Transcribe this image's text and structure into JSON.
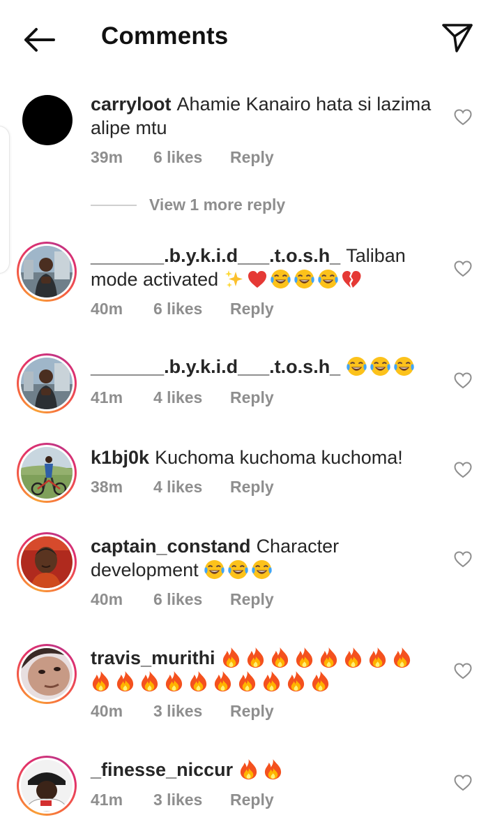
{
  "header": {
    "title": "Comments",
    "back_icon": "arrow-left-icon",
    "share_icon": "paper-plane-icon"
  },
  "view_more_replies": "View 1 more reply",
  "comments": [
    {
      "username": "carryloot",
      "text": "Ahamie Kanairo hata si lazima alipe mtu",
      "time": "39m",
      "likes": "6 likes",
      "reply": "Reply",
      "avatar_style": "black-circle"
    },
    {
      "username": "_______.b.y.k.i.d___.t.o.s.h_",
      "text": "Taliban mode activated",
      "emojis": [
        "sparkles",
        "red-heart",
        "tears-of-joy",
        "tears-of-joy",
        "tears-of-joy",
        "broken-heart"
      ],
      "time": "40m",
      "likes": "6 likes",
      "reply": "Reply"
    },
    {
      "username": "_______.b.y.k.i.d___.t.o.s.h_",
      "text": "",
      "emojis": [
        "tears-of-joy",
        "tears-of-joy",
        "tears-of-joy"
      ],
      "time": "41m",
      "likes": "4 likes",
      "reply": "Reply"
    },
    {
      "username": "k1bj0k",
      "text": "Kuchoma kuchoma kuchoma!",
      "time": "38m",
      "likes": "4 likes",
      "reply": "Reply"
    },
    {
      "username": "captain_constand",
      "text": "Character development",
      "emojis": [
        "tears-of-joy",
        "tears-of-joy",
        "tears-of-joy"
      ],
      "time": "40m",
      "likes": "6 likes",
      "reply": "Reply"
    },
    {
      "username": "travis_murithi",
      "text": "",
      "emojis": [
        "fire",
        "fire",
        "fire",
        "fire",
        "fire",
        "fire",
        "fire",
        "fire",
        "fire",
        "fire",
        "fire",
        "fire",
        "fire",
        "fire",
        "fire",
        "fire",
        "fire",
        "fire"
      ],
      "time": "40m",
      "likes": "3 likes",
      "reply": "Reply"
    },
    {
      "username": "_finesse_niccur",
      "text": "",
      "emojis": [
        "fire",
        "fire"
      ],
      "time": "41m",
      "likes": "3 likes",
      "reply": "Reply"
    }
  ],
  "colors": {
    "text": "#262626",
    "meta": "#8e8e8e",
    "story_ring_start": "#f9a037",
    "story_ring_end": "#c13584"
  }
}
